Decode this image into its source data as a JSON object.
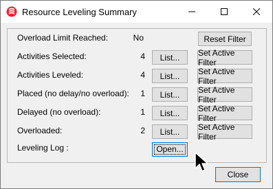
{
  "window": {
    "title": "Resource Leveling Summary",
    "icon": "app-logo-icon",
    "controls": [
      "minimize-icon",
      "maximize-icon",
      "close-icon"
    ],
    "accent_color": "#0078d7",
    "icon_color": "#e0282e"
  },
  "summary": {
    "overload_limit": {
      "label": "Overload Limit Reached:",
      "value": "No",
      "button": "Reset Filter"
    },
    "activities_selected": {
      "label": "Activities Selected:",
      "value": "4",
      "list_button": "List...",
      "filter_button": "Set Active Filter"
    },
    "activities_leveled": {
      "label": "Activities Leveled:",
      "value": "4",
      "list_button": "List...",
      "filter_button": "Set Active Filter"
    },
    "placed": {
      "label": "Placed (no delay/no overload):",
      "value": "1",
      "list_button": "List...",
      "filter_button": "Set Active Filter"
    },
    "delayed": {
      "label": "Delayed (no overload):",
      "value": "1",
      "list_button": "List...",
      "filter_button": "Set Active Filter"
    },
    "overloaded": {
      "label": "Overloaded:",
      "value": "2",
      "list_button": "List...",
      "filter_button": "Set Active Filter"
    },
    "leveling_log": {
      "label": "Leveling Log :",
      "button": "Open..."
    }
  },
  "footer": {
    "close_button": "Close"
  }
}
